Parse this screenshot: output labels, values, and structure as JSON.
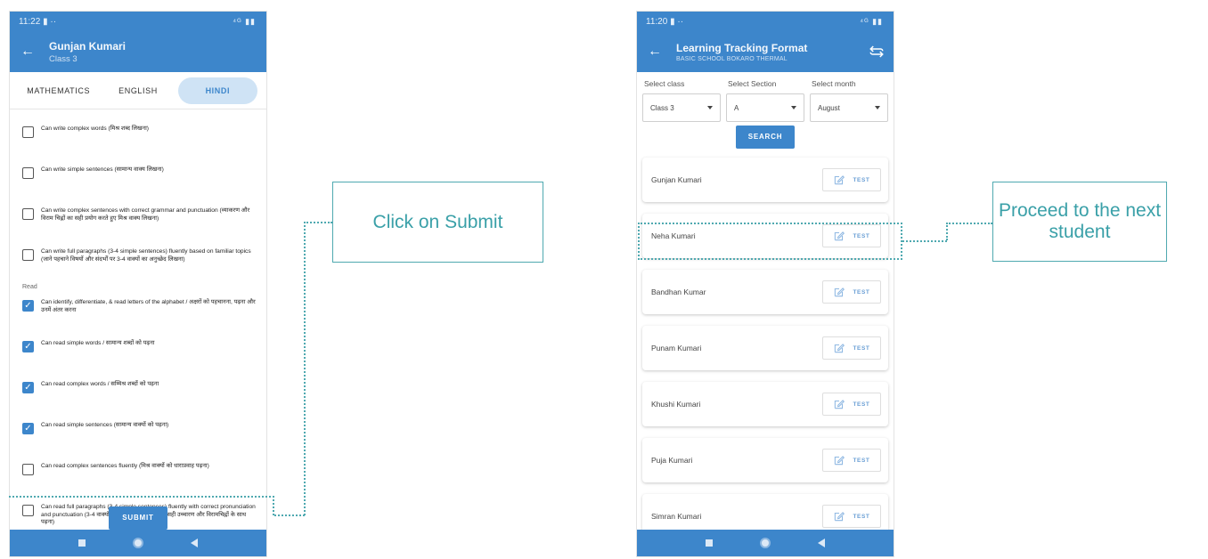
{
  "left_phone": {
    "status": {
      "time": "11:22",
      "icons": "▮ ··",
      "right": "⁴ᴳ ▮▮"
    },
    "header": {
      "title": "Gunjan Kumari",
      "subtitle": "Class 3"
    },
    "tabs": [
      {
        "label": "MATHEMATICS",
        "active": false
      },
      {
        "label": "ENGLISH",
        "active": false
      },
      {
        "label": "HINDI",
        "active": true
      }
    ],
    "items_write": [
      {
        "text": "Can write complex words (मिश्र शब्द लिखना)",
        "checked": false
      },
      {
        "text": "Can write simple sentences (सामान्य वाक्य लिखना)",
        "checked": false
      },
      {
        "text": "Can write complex sentences with correct grammar and punctuation (व्याकरण और विराम चिह्नों का सही प्रयोग करते हुए मिश्र वाक्य लिखना)",
        "checked": false
      },
      {
        "text": "Can write full paragraphs (3-4 simple sentences) fluently based on familiar topics (जाने पहचाने विषयों और संदर्भों पर 3-4 वाक्यों का अनुच्छेद लिखना)",
        "checked": false
      }
    ],
    "read_label": "Read",
    "items_read": [
      {
        "text": "Can identify, differentiate, & read letters of the alphabet / अक्षरों को पहचानना, पढ़ना और उनमें अंतर करना",
        "checked": true
      },
      {
        "text": "Can read simple words / सामान्य शब्दों को पढ़ना",
        "checked": true
      },
      {
        "text": "Can read complex words / सम्मिश्र शब्दों को पढ़ना",
        "checked": true
      },
      {
        "text": "Can read simple sentences (सामान्य वाक्यों को पढ़ना)",
        "checked": true
      },
      {
        "text": "Can read complex sentences fluently (मिश्र वाक्यों को धाराप्रवाह पढ़ना)",
        "checked": false
      },
      {
        "text": "Can read full paragraphs (3-4 simple sentences) fluently with correct pronunciation and punctuation (3-4 वाक्यों के अनुच्छेदों को धाराप्रवाह सही उच्चारण और विरामचिह्नों के साथ पढ़ना)",
        "checked": false
      }
    ],
    "submit_label": "SUBMIT"
  },
  "right_phone": {
    "status": {
      "time": "11:20",
      "icons": "▮ ··",
      "right": "⁴ᴳ ▮▮"
    },
    "header": {
      "title": "Learning Tracking Format",
      "subtitle": "BASIC SCHOOL BOKARO THERMAL"
    },
    "filters": [
      {
        "label": "Select class",
        "value": "Class 3"
      },
      {
        "label": "Select Section",
        "value": "A"
      },
      {
        "label": "Select month",
        "value": "August"
      }
    ],
    "search_label": "SEARCH",
    "students": [
      {
        "name": "Gunjan Kumari",
        "action": "TEST"
      },
      {
        "name": "Neha Kumari",
        "action": "TEST"
      },
      {
        "name": "Bandhan Kumar",
        "action": "TEST"
      },
      {
        "name": "Punam Kumari",
        "action": "TEST"
      },
      {
        "name": "Khushi Kumari",
        "action": "TEST"
      },
      {
        "name": "Puja Kumari",
        "action": "TEST"
      },
      {
        "name": "Simran Kumari",
        "action": "TEST"
      }
    ]
  },
  "callouts": {
    "submit": "Click on Submit",
    "next": "Proceed to the next student"
  },
  "colors": {
    "primary": "#3d86cb",
    "callout": "#3aa0a8",
    "tab_active_bg": "#cfe3f5"
  },
  "icons": [
    "back-arrow-icon",
    "swap-icon",
    "edit-icon",
    "caret-down-icon",
    "check-icon",
    "nav-square-icon",
    "nav-home-icon",
    "nav-back-icon"
  ]
}
